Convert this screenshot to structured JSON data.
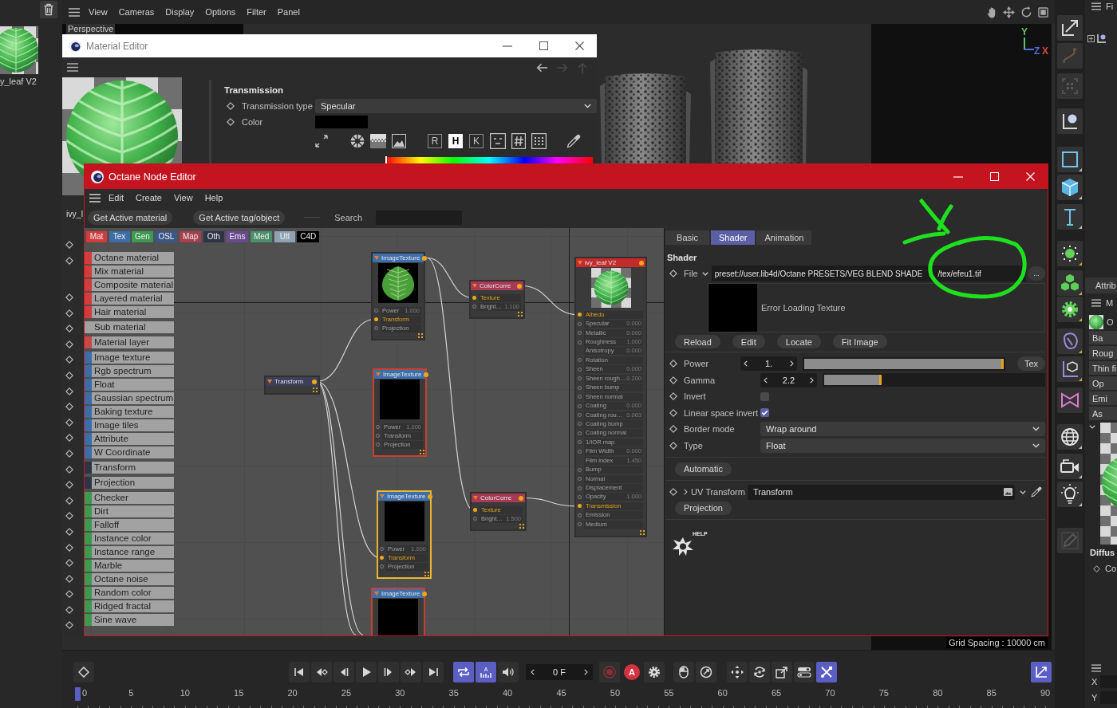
{
  "viewport": {
    "menu": [
      "View",
      "Cameras",
      "Display",
      "Options",
      "Filter",
      "Panel"
    ],
    "camera": "Perspective",
    "axes": [
      {
        "label": "Y",
        "color": "#5fc26a"
      },
      {
        "label": "Z",
        "color": "#4f6fd8"
      },
      {
        "label": "X",
        "color": "#d84848"
      }
    ],
    "grid_spacing": "Grid Spacing : 10000 cm"
  },
  "material_manager": {
    "material": "y_leaf V2"
  },
  "material_editor": {
    "title": "Material Editor",
    "name": "ivy_l",
    "section": "Transmission",
    "fields": [
      {
        "kind": "dropdown",
        "label": "Transmission type",
        "value": "Specular"
      },
      {
        "kind": "swatch",
        "label": "Color",
        "color": "#000000"
      }
    ],
    "color_modes": [
      {
        "label": "R",
        "selected": false
      },
      {
        "label": "H",
        "selected": true
      },
      {
        "label": "K",
        "selected": false
      }
    ],
    "hue": {
      "level": 0
    }
  },
  "node_editor": {
    "title": "Octane Node Editor",
    "menu": [
      "Edit",
      "Create",
      "View",
      "Help"
    ],
    "toolbar": [
      "Get Active material",
      "Get Active tag/object"
    ],
    "search": {
      "label": "Search"
    },
    "categories": [
      {
        "label": "Mat",
        "color": "#d23c3c"
      },
      {
        "label": "Tex",
        "color": "#3b6ea8"
      },
      {
        "label": "Gen",
        "color": "#3b9a50"
      },
      {
        "label": "OSL",
        "color": "#3a5687"
      },
      {
        "label": "Map",
        "color": "#a73f4c"
      },
      {
        "label": "Oth",
        "color": "#2e3446"
      },
      {
        "label": "Ems",
        "color": "#684a8c"
      },
      {
        "label": "Med",
        "color": "#4b8f6c"
      },
      {
        "label": "Utl",
        "color": "#8ea2b4"
      },
      {
        "label": "C4D",
        "color": "#000000"
      }
    ],
    "palette": [
      [
        {
          "label": "Octane material",
          "color": "#d23c3c"
        },
        {
          "label": "Mix material",
          "color": "#d23c3c"
        },
        {
          "label": "Composite material",
          "color": "#d23c3c"
        },
        {
          "label": "Layered material",
          "color": "#d23c3c"
        },
        {
          "label": "Hair material",
          "color": "#d23c3c"
        }
      ],
      [
        {
          "label": "Sub material"
        }
      ],
      [
        {
          "label": "Material layer",
          "color": "#c84848"
        }
      ],
      [
        {
          "label": "Image texture",
          "color": "#3b6ea8"
        },
        {
          "label": "Rgb spectrum",
          "color": "#3b6ea8"
        },
        {
          "label": "Float",
          "color": "#3b6ea8"
        },
        {
          "label": "Gaussian spectrum",
          "color": "#3b6ea8"
        },
        {
          "label": "Baking texture",
          "color": "#3b6ea8"
        },
        {
          "label": "Image tiles",
          "color": "#3b6ea8"
        },
        {
          "label": "Attribute",
          "color": "#3b6ea8"
        },
        {
          "label": "W Coordinate",
          "color": "#3b6ea8"
        }
      ],
      [
        {
          "label": "Transform",
          "color": "#2e3446"
        }
      ],
      [
        {
          "label": "Projection",
          "color": "#2e3446"
        }
      ],
      [
        {
          "label": "Checker",
          "color": "#3b9a50"
        },
        {
          "label": "Dirt",
          "color": "#3b9a50"
        },
        {
          "label": "Falloff",
          "color": "#3b9a50"
        },
        {
          "label": "Instance color",
          "color": "#3b9a50"
        },
        {
          "label": "Instance range",
          "color": "#3b9a50"
        },
        {
          "label": "Marble",
          "color": "#3b9a50"
        },
        {
          "label": "Octane noise",
          "color": "#3b9a50"
        },
        {
          "label": "Random color",
          "color": "#3b9a50"
        },
        {
          "label": "Ridged fractal",
          "color": "#3b9a50"
        },
        {
          "label": "Sine wave",
          "color": "#3b9a50"
        }
      ]
    ],
    "nodes": [
      {
        "kind": "transform",
        "title": "Transform",
        "selected": false,
        "error": false
      },
      {
        "kind": "texture",
        "title": "ImageTexture",
        "preview": {
          "kind": "leaf"
        },
        "selected": false,
        "error": false,
        "ports": [
          {
            "label": "Power",
            "value": "1.000",
            "connected": false
          },
          {
            "label": "Transform",
            "connected": true
          },
          {
            "label": "Projection",
            "connected": false
          }
        ]
      },
      {
        "kind": "texture",
        "title": "ImageTexture",
        "preview": {
          "kind": "black"
        },
        "selected": false,
        "error": true,
        "ports": [
          {
            "label": "Power",
            "value": "1.000",
            "connected": false
          },
          {
            "label": "Transform",
            "connected": false
          },
          {
            "label": "Projection",
            "connected": false
          }
        ]
      },
      {
        "kind": "texture",
        "title": "ImageTexture",
        "preview": {
          "kind": "black"
        },
        "selected": true,
        "error": false,
        "ports": [
          {
            "label": "Power",
            "value": "1.000",
            "connected": false
          },
          {
            "label": "Transform",
            "connected": true
          },
          {
            "label": "Projection",
            "connected": false
          }
        ]
      },
      {
        "kind": "texture",
        "title": "ImageTexture",
        "preview": {
          "kind": "black"
        },
        "selected": false,
        "error": true
      },
      {
        "kind": "colorcorrect",
        "title": "ColorCorre",
        "selected": false,
        "error": false,
        "ports": [
          {
            "label": "Texture",
            "connected": true
          },
          {
            "label": "Bright…",
            "value": "1.100",
            "connected": false
          }
        ]
      },
      {
        "kind": "colorcorrect",
        "title": "ColorCorre",
        "selected": false,
        "error": false,
        "ports": [
          {
            "label": "Texture",
            "connected": true
          },
          {
            "label": "Bright…",
            "value": "1.500",
            "connected": false
          }
        ]
      },
      {
        "kind": "material",
        "title": "ivy_leaf V2",
        "preview": {
          "kind": "sphere"
        },
        "selected": false,
        "error": false,
        "ports": [
          {
            "label": "Albedo",
            "connected": true,
            "socket": true
          },
          {
            "label": "Specular",
            "value": "0.000",
            "connected": false,
            "socket": true
          },
          {
            "label": "Metallic",
            "value": "0.000",
            "connected": false,
            "socket": true
          },
          {
            "label": "Roughness",
            "value": "1.000",
            "connected": false,
            "socket": true
          },
          {
            "label": "Anisotropy",
            "value": "0.000",
            "connected": false,
            "socket": false
          },
          {
            "label": "Rotation",
            "connected": false,
            "socket": true
          },
          {
            "label": "Sheen",
            "value": "0.000",
            "connected": false,
            "socket": true
          },
          {
            "label": "Sheen rough…",
            "value": "0.200",
            "connected": false,
            "socket": true
          },
          {
            "label": "Sheen bump",
            "connected": false,
            "socket": true
          },
          {
            "label": "Sheen normal",
            "connected": false,
            "socket": true
          },
          {
            "label": "Coating",
            "value": "0.000",
            "connected": false,
            "socket": true
          },
          {
            "label": "Coating rou…",
            "value": "0.063",
            "connected": false,
            "socket": true
          },
          {
            "label": "Coating bump",
            "connected": false,
            "socket": true
          },
          {
            "label": "Coating normal",
            "connected": false,
            "socket": true
          },
          {
            "label": "1/IOR map",
            "connected": false,
            "socket": true
          },
          {
            "label": "Film Width",
            "value": "0.000",
            "connected": false,
            "socket": true
          },
          {
            "label": "Film index",
            "value": "1.450",
            "connected": false,
            "socket": false
          },
          {
            "label": "Bump",
            "connected": false,
            "socket": true
          },
          {
            "label": "Normal",
            "connected": false,
            "socket": true
          },
          {
            "label": "Displacement",
            "connected": false,
            "socket": true
          },
          {
            "label": "Opacity",
            "value": "1.000",
            "connected": false,
            "socket": true
          },
          {
            "label": "Transmission",
            "connected": true,
            "socket": true
          },
          {
            "label": "Emission",
            "connected": false,
            "socket": true
          },
          {
            "label": "Medium",
            "connected": false,
            "socket": true
          }
        ]
      }
    ],
    "inspector": {
      "tabs": [
        {
          "label": "Basic",
          "selected": false
        },
        {
          "label": "Shader",
          "selected": true
        },
        {
          "label": "Animation",
          "selected": false
        }
      ],
      "heading": "Shader",
      "file": {
        "label": "File",
        "value_parts": [
          "preset://user.lib4d/Octane PRESETS/VEG BLEND SHADE",
          "/tex/efeu1.tif"
        ],
        "button": "..."
      },
      "preview_message": "Error Loading Texture",
      "actions": [
        "Reload",
        "Edit",
        "Locate",
        "Fit Image"
      ],
      "params": [
        {
          "kind": "slider",
          "label": "Power",
          "value": "1.",
          "level": 1,
          "button": "Tex"
        },
        {
          "kind": "slider",
          "label": "Gamma",
          "value": "2.2",
          "level": 0.26
        },
        {
          "kind": "checkbox",
          "label": "Invert",
          "checked": false
        },
        {
          "kind": "checkbox",
          "label": "Linear space invert",
          "checked": true
        },
        {
          "kind": "dropdown",
          "label": "Border mode",
          "value": "Wrap around"
        },
        {
          "kind": "dropdown",
          "label": "Type",
          "value": "Float"
        }
      ],
      "automatic": "Automatic",
      "uv_transform": {
        "label": "UV Transform",
        "value": "Transform",
        "expanded": false
      },
      "projection": "Projection",
      "help": "HELP"
    }
  },
  "annotations": [
    {
      "kind": "cross"
    },
    {
      "kind": "circle"
    }
  ],
  "timeline": {
    "groups": [
      [
        {
          "kind": "keyframe",
          "selected": false
        }
      ],
      [
        {
          "kind": "first",
          "selected": false
        },
        {
          "kind": "prevkey",
          "selected": false
        },
        {
          "kind": "prevframe",
          "selected": false
        },
        {
          "kind": "play",
          "selected": false
        },
        {
          "kind": "nextframe",
          "selected": false
        },
        {
          "kind": "nextkey",
          "selected": false
        },
        {
          "kind": "last",
          "selected": false
        }
      ],
      [
        {
          "kind": "loop",
          "selected": true
        },
        {
          "kind": "keybars",
          "label": "A",
          "selected": true
        },
        {
          "kind": "sound",
          "selected": false
        }
      ],
      [
        {
          "kind": "frame",
          "value": "0 F"
        }
      ],
      [
        {
          "kind": "record",
          "selected": false
        },
        {
          "kind": "autokey",
          "label": "A",
          "selected": false
        },
        {
          "kind": "gear",
          "selected": false
        }
      ],
      [
        {
          "kind": "mouse",
          "selected": false
        },
        {
          "kind": "dial",
          "selected": false
        }
      ],
      [
        {
          "kind": "move",
          "selected": false
        },
        {
          "kind": "rotate",
          "selected": false
        },
        {
          "kind": "scale",
          "selected": false
        },
        {
          "kind": "toggle",
          "selected": false
        },
        {
          "kind": "snap",
          "selected": true
        }
      ],
      [
        {
          "kind": "axis",
          "selected": true
        }
      ]
    ],
    "ruler": [
      "0",
      "5",
      "10",
      "15",
      "20",
      "25",
      "30",
      "35",
      "40",
      "45",
      "50",
      "55",
      "60",
      "65",
      "70",
      "75",
      "80",
      "85",
      "90"
    ]
  },
  "attribute_panel": {
    "header": "Fi",
    "tab": "Attrib",
    "mode": "M",
    "object": "O",
    "buttons": [
      "Ba",
      "Roug",
      "Thin fi",
      "Op",
      "Emi",
      "As"
    ],
    "section": "Diffus",
    "row": "Co",
    "coords": [
      "X",
      "Y"
    ]
  }
}
